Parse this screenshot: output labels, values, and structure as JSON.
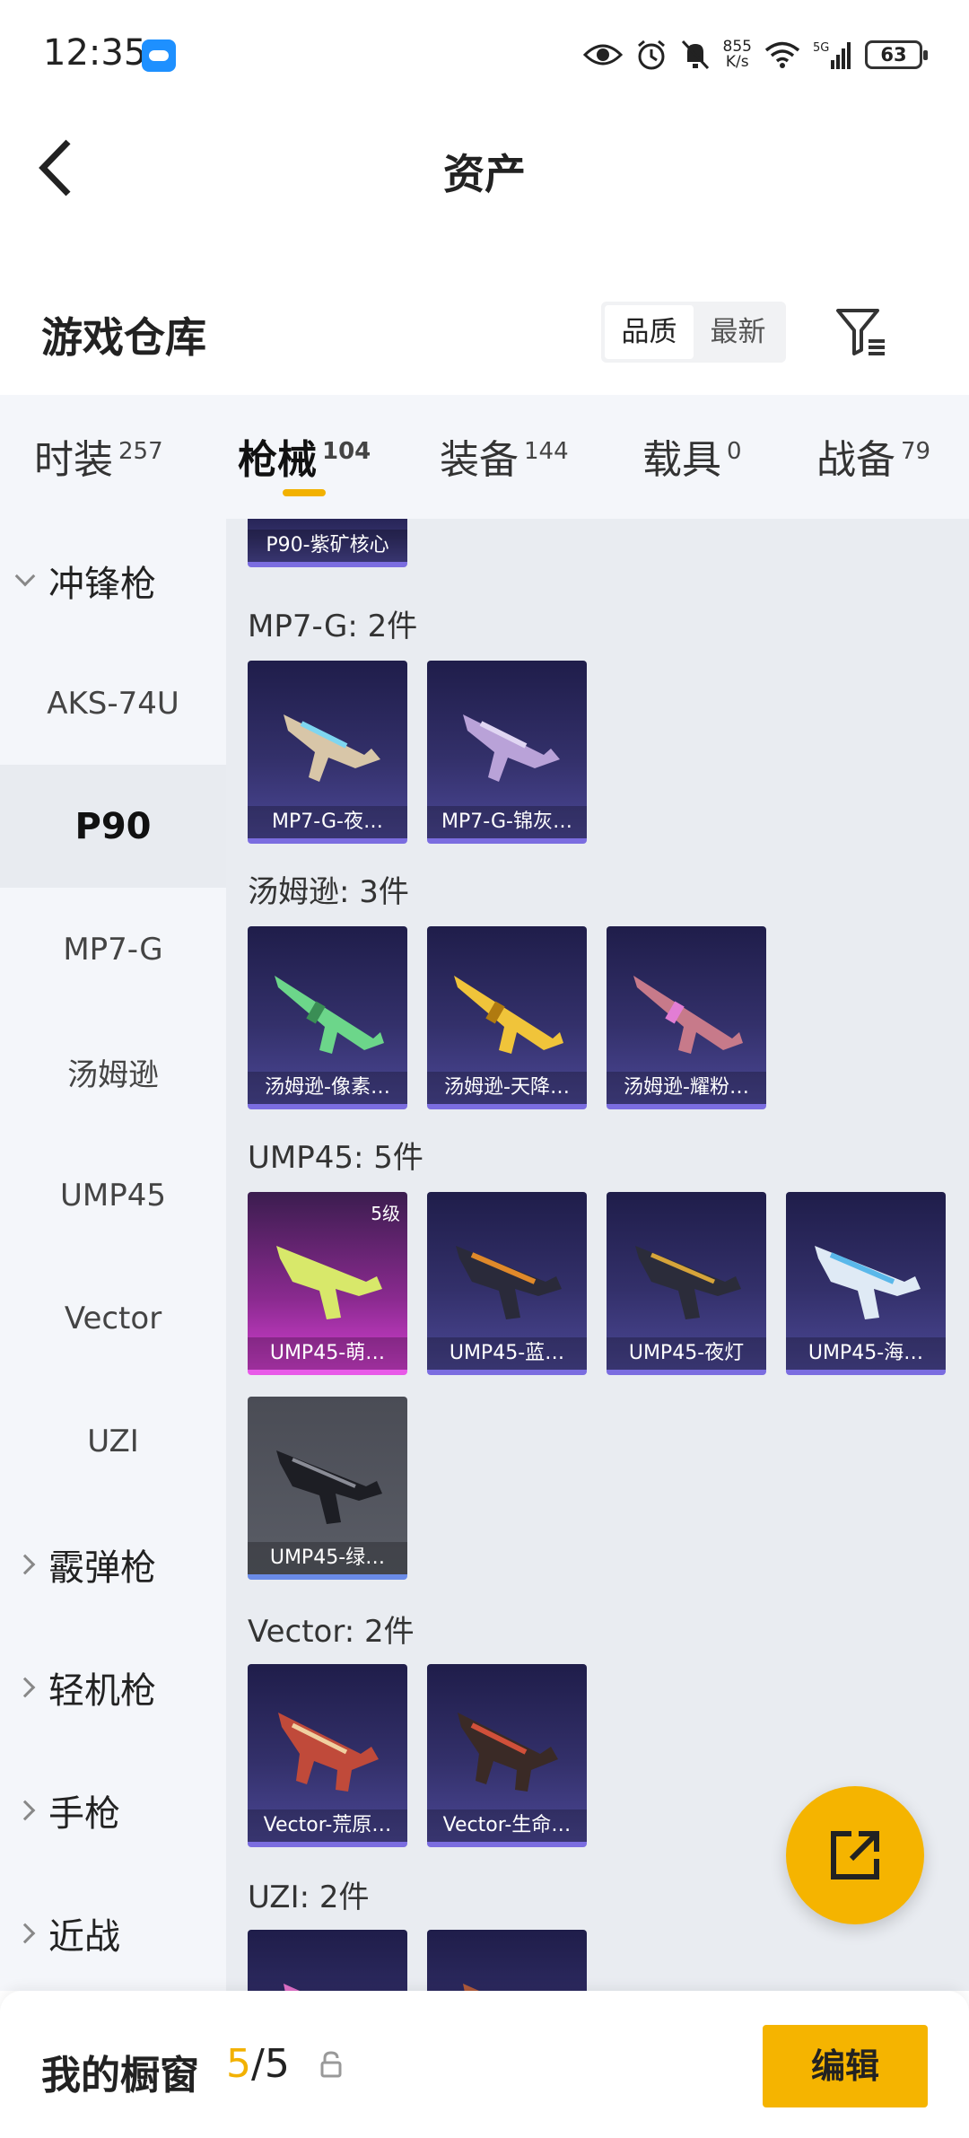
{
  "status_bar": {
    "time": "12:35",
    "net_speed_value": "855",
    "net_speed_unit": "K/s",
    "battery": "63"
  },
  "header": {
    "title": "资产"
  },
  "warehouse": {
    "title": "游戏仓库",
    "sort_quality": "品质",
    "sort_latest": "最新"
  },
  "tabs": [
    {
      "label": "时装",
      "count": "257"
    },
    {
      "label": "枪械",
      "count": "104"
    },
    {
      "label": "装备",
      "count": "144"
    },
    {
      "label": "载具",
      "count": "0"
    },
    {
      "label": "战备",
      "count": "79"
    }
  ],
  "sidebar": {
    "group_smg": "冲锋枪",
    "items": [
      "AKS-74U",
      "P90",
      "MP7-G",
      "汤姆逊",
      "UMP45",
      "Vector",
      "UZI"
    ],
    "group_shotgun": "霰弹枪",
    "group_lmg": "轻机枪",
    "group_pistol": "手枪",
    "group_melee": "近战"
  },
  "content": {
    "p90_partial": "P90-紫矿核心",
    "groups": [
      {
        "title": "MP7-G: 2件",
        "cards": [
          "MP7-G-夜…",
          "MP7-G-锦灰…"
        ]
      },
      {
        "title": "汤姆逊: 3件",
        "cards": [
          "汤姆逊-像素…",
          "汤姆逊-天降…",
          "汤姆逊-耀粉…"
        ]
      },
      {
        "title": "UMP45: 5件",
        "cards": [
          "UMP45-萌…",
          "UMP45-蓝…",
          "UMP45-夜灯",
          "UMP45-海…",
          "UMP45-绿…"
        ],
        "level_badge": "5级"
      },
      {
        "title": "Vector: 2件",
        "cards": [
          "Vector-荒原…",
          "Vector-生命…"
        ]
      },
      {
        "title": "UZI: 2件"
      }
    ]
  },
  "bottom": {
    "showcase_label": "我的橱窗",
    "count_current": "5",
    "count_sep": "/",
    "count_total": "5",
    "edit_label": "编辑"
  },
  "colors": {
    "accent": "#f5b400",
    "card_purple": "#33306a",
    "card_pink": "#d23fd0"
  },
  "icons": [
    "cloud-icon",
    "eye-icon",
    "alarm-icon",
    "mute-icon",
    "wifi-icon",
    "signal-icon",
    "back-icon",
    "filter-icon",
    "chevron-icon",
    "share-icon",
    "lock-icon"
  ]
}
